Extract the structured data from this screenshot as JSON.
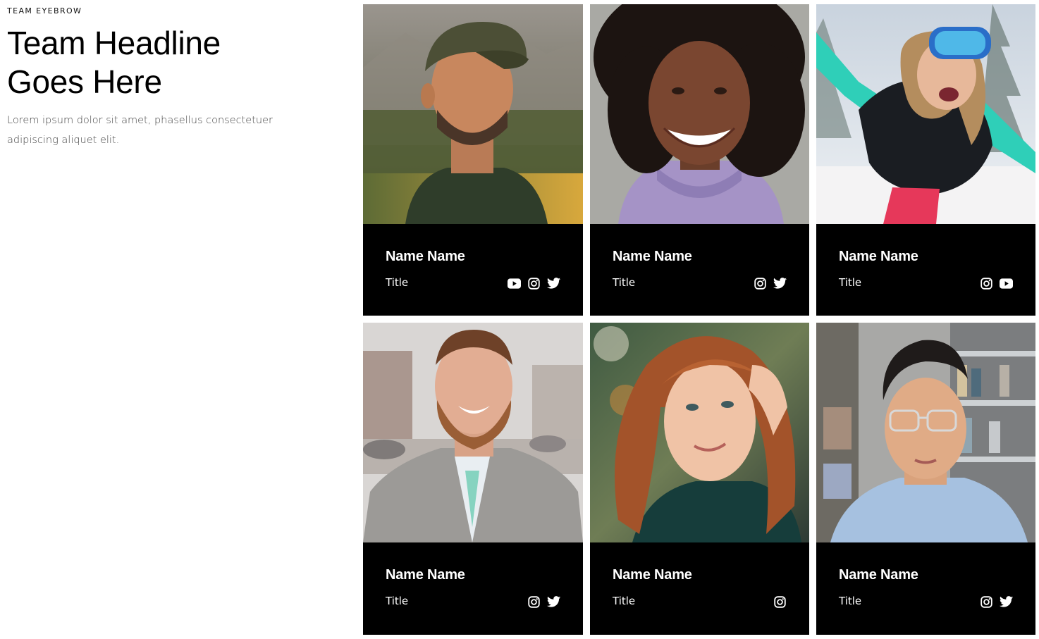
{
  "intro": {
    "eyebrow": "TEAM EYEBROW",
    "headline_line1": "Team Headline",
    "headline_line2": "Goes Here",
    "body": "Lorem ipsum dolor sit amet, phasellus consectetuer adipiscing aliquet elit."
  },
  "members": [
    {
      "name": "Name Name",
      "title": "Title",
      "photo": "portrait-man-cap-mountains",
      "socials": [
        "youtube-icon",
        "instagram-icon",
        "twitter-icon"
      ]
    },
    {
      "name": "Name Name",
      "title": "Title",
      "photo": "portrait-woman-curly-hair-lavender-hoodie",
      "socials": [
        "instagram-icon",
        "twitter-icon"
      ]
    },
    {
      "name": "Name Name",
      "title": "Title",
      "photo": "portrait-woman-ski-goggles-snow",
      "socials": [
        "instagram-icon",
        "youtube-icon"
      ]
    },
    {
      "name": "Name Name",
      "title": "Title",
      "photo": "portrait-man-beard-fleece-street",
      "socials": [
        "instagram-icon",
        "twitter-icon"
      ]
    },
    {
      "name": "Name Name",
      "title": "Title",
      "photo": "portrait-woman-red-hair",
      "socials": [
        "instagram-icon"
      ]
    },
    {
      "name": "Name Name",
      "title": "Title",
      "photo": "portrait-man-glasses-store",
      "socials": [
        "instagram-icon",
        "twitter-icon"
      ]
    }
  ],
  "colors": {
    "card_background": "#000000",
    "text_on_card": "#ffffff",
    "body_text": "#444444"
  }
}
